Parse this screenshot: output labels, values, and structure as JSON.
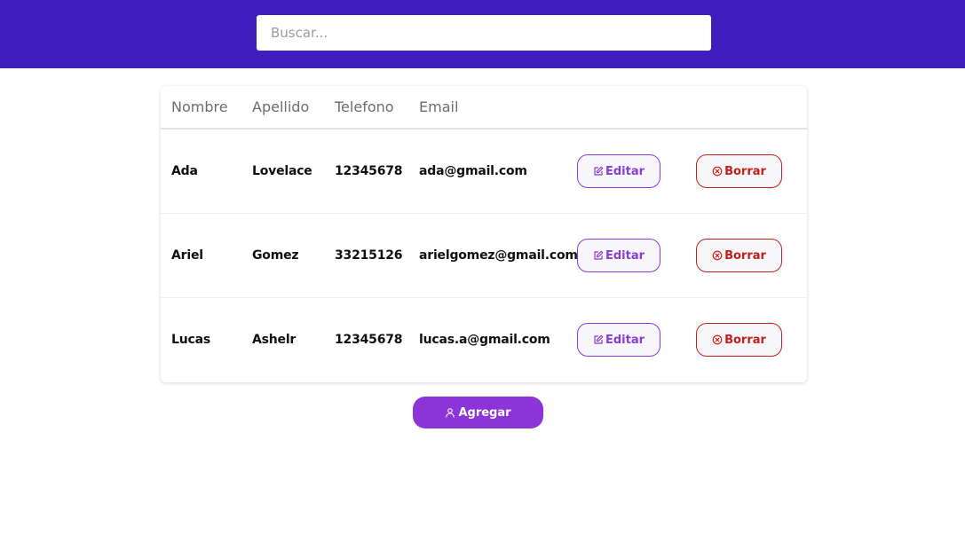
{
  "search": {
    "placeholder": "Buscar..."
  },
  "table": {
    "columns": [
      "Nombre",
      "Apellido",
      "Telefono",
      "Email"
    ],
    "rows": [
      {
        "nombre": "Ada",
        "apellido": "Lovelace",
        "telefono": "12345678",
        "email": "ada@gmail.com"
      },
      {
        "nombre": "Ariel",
        "apellido": "Gomez",
        "telefono": "33215126",
        "email": "arielgomez@gmail.com"
      },
      {
        "nombre": "Lucas",
        "apellido": "Ashelr",
        "telefono": "12345678",
        "email": "lucas.a@gmail.com"
      }
    ],
    "edit_label": "Editar",
    "delete_label": "Borrar"
  },
  "add_label": "Agregar",
  "colors": {
    "header_bg": "#3f1dbf",
    "edit": "#8a3bd6",
    "delete": "#c0201c",
    "add_bg": "#8b35d9"
  },
  "icons": {
    "edit": "edit-icon",
    "delete": "x-circle-icon",
    "add": "user-icon"
  }
}
